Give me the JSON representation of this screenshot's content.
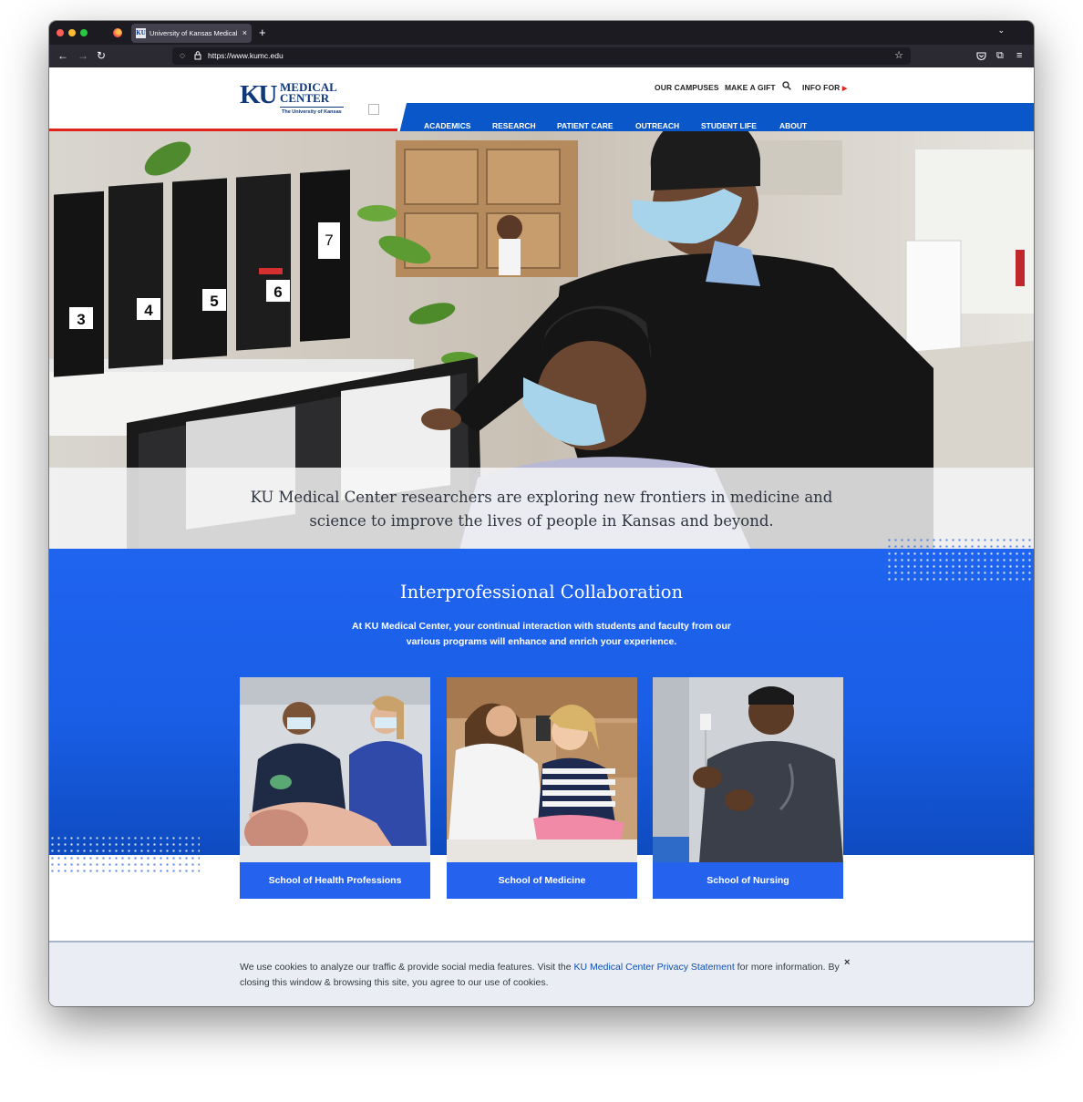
{
  "browser": {
    "tab_title": "University of Kansas Medical Ce",
    "tab_favicon": "KU",
    "tab_close": "×",
    "new_tab": "+",
    "tab_list": "⌄",
    "url": "https://www.kumc.edu",
    "icons": [
      "back-arrow-icon",
      "forward-arrow-icon",
      "reload-icon",
      "shield-icon",
      "lock-icon",
      "bookmark-star-icon",
      "pocket-icon",
      "extensions-icon",
      "menu-icon"
    ]
  },
  "header": {
    "logo_ku": "KU",
    "logo_medical": "MEDICAL",
    "logo_center": "CENTER",
    "logo_sub": "The University of Kansas",
    "utility_links": [
      "OUR CAMPUSES",
      "MAKE A GIFT",
      "INFO FOR"
    ],
    "main_nav": [
      "ACADEMICS",
      "RESEARCH",
      "PATIENT CARE",
      "OUTREACH",
      "STUDENT LIFE",
      "ABOUT"
    ]
  },
  "hero": {
    "binder_numbers": [
      "3",
      "4",
      "5",
      "6",
      "7"
    ],
    "caption": "KU Medical Center researchers are exploring new frontiers in medicine and science to improve the lives of people in Kansas and beyond."
  },
  "collaboration": {
    "title": "Interprofessional Collaboration",
    "description": "At KU Medical Center, your continual interaction with students and faculty from our various programs will enhance and enrich your experience.",
    "cards": [
      {
        "label": "School of Health Professions"
      },
      {
        "label": "School of Medicine"
      },
      {
        "label": "School of Nursing"
      }
    ]
  },
  "cookie_banner": {
    "text_before": "We use cookies to analyze our traffic & provide social media features. Visit the ",
    "link": "KU Medical Center Privacy Statement",
    "text_after": " for more information. By closing this window & browsing this site, you agree to our use of cookies.",
    "close": "×"
  },
  "colors": {
    "brand_navy": "#0f3878",
    "nav_blue": "#0a57c9",
    "accent_red": "#e1241b",
    "section_blue": "#1f64ef",
    "card_label_blue": "#2563ee"
  }
}
